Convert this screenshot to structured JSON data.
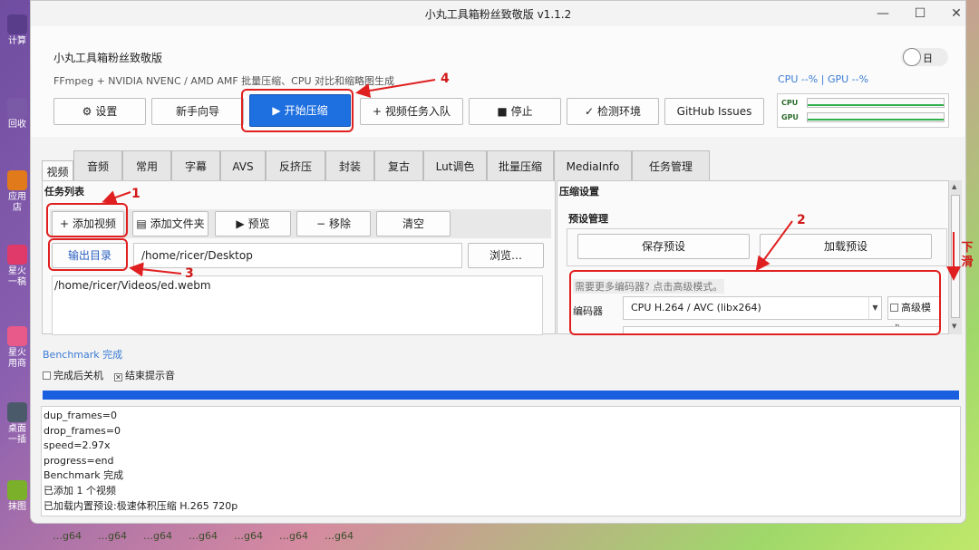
{
  "window": {
    "title": "小丸工具箱粉丝致敬版 v1.1.2",
    "controls": {
      "minimize": "—",
      "maximize": "☐",
      "close": "✕"
    }
  },
  "header": {
    "app_name": "小丸工具箱粉丝致敬版",
    "subtitle": "FFmpeg + NVIDIA NVENC / AMD AMF 批量压缩、CPU 对比和缩略图生成",
    "theme_toggle_label": "日",
    "usage": "CPU --% | GPU --%",
    "monitor": {
      "cpu_label": "CPU",
      "gpu_label": "GPU"
    }
  },
  "toolbar": {
    "settings": {
      "icon": "⚙",
      "label": "设置"
    },
    "wizard": "新手向导",
    "start": {
      "icon": "▶",
      "label": "开始压缩"
    },
    "enqueue": {
      "icon": "+",
      "label": "视频任务入队"
    },
    "stop": {
      "icon": "■",
      "label": "停止"
    },
    "check_env": {
      "icon": "✓",
      "label": "检测环境"
    },
    "issues": "GitHub Issues"
  },
  "tabs": [
    "视频",
    "音频",
    "常用",
    "字幕",
    "AVS",
    "反挤压",
    "封装",
    "复古",
    "Lut调色",
    "批量压缩",
    "MediaInfo",
    "任务管理"
  ],
  "task_list": {
    "title": "任务列表",
    "add_video": {
      "icon": "+",
      "label": "添加视频"
    },
    "add_folder": {
      "icon": "▤",
      "label": "添加文件夹"
    },
    "preview": {
      "icon": "▶",
      "label": "预览"
    },
    "remove": {
      "icon": "−",
      "label": "移除"
    },
    "clear": "清空",
    "output_dir_label": "输出目录",
    "output_dir_value": "/home/ricer/Desktop",
    "browse": "浏览…",
    "items": [
      "/home/ricer/Videos/ed.webm"
    ]
  },
  "compress": {
    "title": "压缩设置",
    "preset_title": "预设管理",
    "save_preset": "保存预设",
    "load_preset": "加载预设",
    "hint": "需要更多编码器? 点击高级模式。",
    "encoder_label": "编码器",
    "encoder_value": "CPU H.264 / AVC (libx264)",
    "advanced_label": "高级模式"
  },
  "status": {
    "text": "Benchmark 完成",
    "shutdown_label": "完成后关机",
    "shutdown_checked": false,
    "beep_label": "结束提示音",
    "beep_checked": true,
    "progress": 1.0
  },
  "log": [
    "dup_frames=0",
    "drop_frames=0",
    "speed=2.97x",
    "progress=end",
    "Benchmark 完成",
    "已添加 1 个视频",
    "已加载内置预设:极速体积压缩 H.265 720p"
  ],
  "annotations": {
    "n1": "1",
    "n2": "2",
    "n3": "3",
    "n4": "4",
    "scroll_note": "下滑"
  },
  "desktop": {
    "icon_labels": [
      "计算",
      "回收",
      "应用店",
      "星火一稿",
      "星火用商",
      "桌面一插",
      "抹图"
    ],
    "taskbar_items": [
      "…g64",
      "…g64",
      "…g64",
      "…g64",
      "…g64",
      "…g64",
      "…g64"
    ]
  },
  "colors": {
    "primary": "#1e6fe0",
    "annotation": "#e02020",
    "accent_text": "#3a7bd5"
  }
}
